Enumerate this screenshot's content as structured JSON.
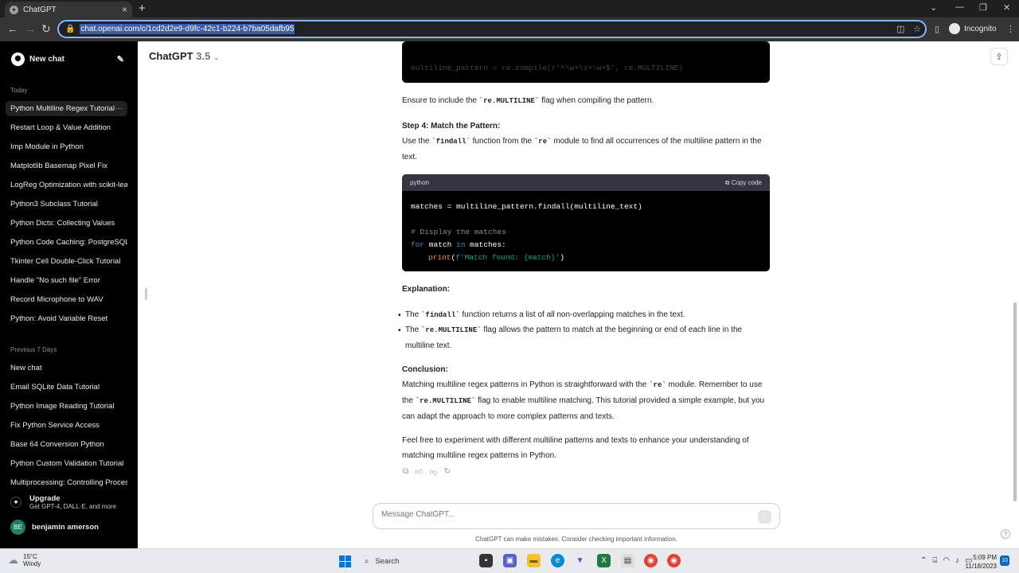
{
  "browser": {
    "tab_title": "ChatGPT",
    "url": "chat.openai.com/c/1cd2d2e9-d9fc-42c1-b224-b7ba05dafb95",
    "profile_label": "Incognito"
  },
  "sidebar": {
    "new_chat": "New chat",
    "sections": [
      {
        "title": "Today"
      },
      {
        "title": "Previous 7 Days"
      }
    ],
    "today_items": [
      "Python Multiline Regex Tutorial",
      "Restart Loop & Value Addition",
      "Imp Module in Python",
      "Matplotlib Basemap Pixel Fix",
      "LogReg Optimization with scikit-learn",
      "Python3 Subclass Tutorial",
      "Python Dicts: Collecting Values",
      "Python Code Caching: PostgreSQL",
      "Tkinter Cell Double-Click Tutorial",
      "Handle \"No such file\" Error",
      "Record Microphone to WAV",
      "Python: Avoid Variable Reset"
    ],
    "week_items": [
      "New chat",
      "Email SQLite Data Tutorial",
      "Python Image Reading Tutorial",
      "Fix Python Service Access",
      "Base 64 Conversion Python",
      "Python Custom Validation Tutorial",
      "Multiprocessing: Controlling Processes"
    ],
    "upgrade_title": "Upgrade",
    "upgrade_sub": "Get GPT-4, DALL·E, and more",
    "user_initials": "BE",
    "user_name": "benjamin amerson"
  },
  "header": {
    "model": "ChatGPT",
    "version": "3.5"
  },
  "content": {
    "top_code_line": "multiline_pattern = re.compile(r'^\\w+\\s+\\w+$', re.MULTILINE)",
    "ensure_text_1": "Ensure to include the ",
    "ensure_code": "`re.MULTILINE`",
    "ensure_text_2": " flag when compiling the pattern.",
    "step4_title": "Step 4: Match the Pattern:",
    "step4_text_1": "Use the ",
    "step4_code_1": "`findall`",
    "step4_text_2": " function from the ",
    "step4_code_2": "`re`",
    "step4_text_3": " module to find all occurrences of the multiline pattern in the text.",
    "code_lang": "python",
    "copy_label": "Copy code",
    "code_line1": "matches = multiline_pattern.findall(multiline_text)",
    "code_comment": "# Display the matches",
    "code_for_kw": "for",
    "code_for_var": " match ",
    "code_in_kw": "in",
    "code_for_rest": " matches:",
    "code_print": "print",
    "code_fstring": "f'Match found: {match}'",
    "explanation_title": "Explanation:",
    "bullet1_a": "The ",
    "bullet1_code": "`findall`",
    "bullet1_b": " function returns a list of all non-overlapping matches in the text.",
    "bullet2_a": "The ",
    "bullet2_code": "`re.MULTILINE`",
    "bullet2_b": " flag allows the pattern to match at the beginning or end of each line in the multiline text.",
    "conclusion_title": "Conclusion:",
    "conclusion_a": "Matching multiline regex patterns in Python is straightforward with the ",
    "conclusion_code1": "`re`",
    "conclusion_b": " module. Remember to use the ",
    "conclusion_code2": "`re.MULTILINE`",
    "conclusion_c": " flag to enable multiline matching. This tutorial provided a simple example, but you can adapt the approach to more complex patterns and texts.",
    "closing": "Feel free to experiment with different multiline patterns and texts to enhance your understanding of matching multiline regex patterns in Python."
  },
  "composer": {
    "placeholder": "Message ChatGPT...",
    "disclaimer": "ChatGPT can make mistakes. Consider checking important information."
  },
  "taskbar": {
    "temp": "15°C",
    "weather": "Windy",
    "search": "Search",
    "time": "5:09 PM",
    "date": "11/18/2023",
    "notifications": "10"
  }
}
